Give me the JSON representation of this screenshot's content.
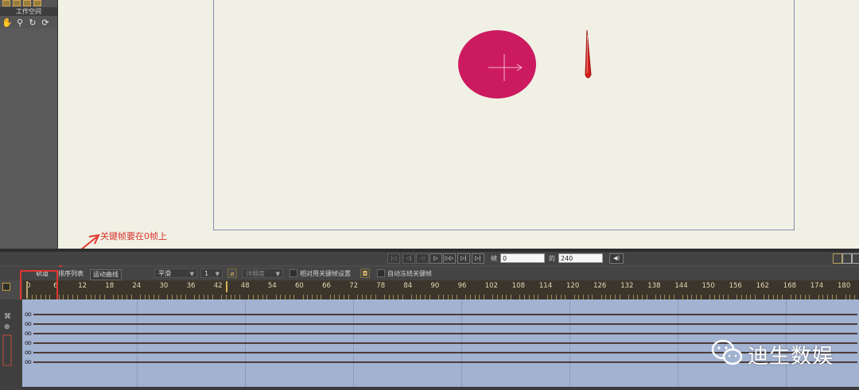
{
  "workspace": {
    "title": "工作空间"
  },
  "annotation": {
    "text": "关键帧要在0帧上",
    "color": "#e2362f"
  },
  "transport": {
    "frame_label": "帧",
    "frame_value": "0",
    "of_label": "的",
    "total_value": "240"
  },
  "toolbar": {
    "tab_track": "轨道",
    "tab_sort": "排序列表",
    "tab_curve": "运动曲线",
    "interp_value": "平滑",
    "step_value": "1",
    "detail_label": "详细度",
    "relative_label": "相对用关键帧设置",
    "auto_label": "自动冻结关键帧"
  },
  "ruler": {
    "ticks": [
      "0",
      "6",
      "12",
      "18",
      "24",
      "30",
      "36",
      "42",
      "48",
      "54",
      "60",
      "66",
      "72",
      "78",
      "84",
      "90",
      "96",
      "102",
      "108",
      "114",
      "120",
      "126",
      "132",
      "138",
      "144",
      "150",
      "156",
      "162",
      "168",
      "174",
      "180"
    ]
  },
  "watermark": {
    "text": "迪生数娱",
    "icon": "wechat-icon"
  },
  "colors": {
    "canvas": "#f1f0e4",
    "ball": "#cc1a60",
    "needle": "#d81f1f",
    "tracks": "#a2b2d1",
    "ruler": "#3b352b"
  }
}
